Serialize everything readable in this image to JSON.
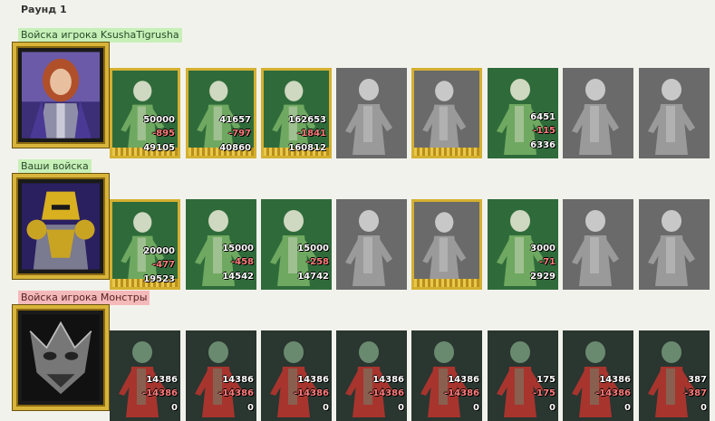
{
  "round": {
    "title": "Раунд 1"
  },
  "colors": {
    "label_green": "#c6f0b8",
    "label_red": "#f4b9b9",
    "gold_frame": "#d4b030",
    "loss_text": "#ff7c7c"
  },
  "sections": [
    {
      "label": "Войска игрока KsushaTigrusha",
      "hero_icon": "female-hero-portrait",
      "units": [
        {
          "icon": "dwarf-unit",
          "gold": true,
          "start": "50000",
          "loss": "-895",
          "remain": "49105",
          "shade": "green"
        },
        {
          "icon": "elf-swordsman-unit",
          "gold": true,
          "start": "41657",
          "loss": "-797",
          "remain": "40860",
          "shade": "green"
        },
        {
          "icon": "elf-lancer-unit",
          "gold": true,
          "start": "162653",
          "loss": "-1841",
          "remain": "160812",
          "shade": "green"
        },
        {
          "icon": "griffin-unit",
          "gold": false,
          "start": "",
          "loss": "",
          "remain": "",
          "shade": "gray"
        },
        {
          "icon": "archer-unit",
          "gold": true,
          "start": "",
          "loss": "",
          "remain": "",
          "shade": "gray"
        },
        {
          "icon": "druid-unit",
          "gold": false,
          "start": "6451",
          "loss": "-115",
          "remain": "6336",
          "shade": "green"
        },
        {
          "icon": "hooded-monk-unit",
          "gold": false,
          "start": "",
          "loss": "",
          "remain": "",
          "shade": "gray"
        },
        {
          "icon": "elder-mage-unit",
          "gold": false,
          "start": "",
          "loss": "",
          "remain": "",
          "shade": "gray"
        }
      ]
    },
    {
      "label": "Ваши войска",
      "hero_icon": "armored-knight-portrait",
      "units": [
        {
          "icon": "dwarf-unit",
          "gold": true,
          "start": "20000",
          "loss": "-477",
          "remain": "19523",
          "shade": "green"
        },
        {
          "icon": "elf-swordsman-unit",
          "gold": false,
          "start": "15000",
          "loss": "-458",
          "remain": "14542",
          "shade": "green"
        },
        {
          "icon": "elf-lancer-unit",
          "gold": false,
          "start": "15000",
          "loss": "-258",
          "remain": "14742",
          "shade": "green"
        },
        {
          "icon": "griffin-unit",
          "gold": false,
          "start": "",
          "loss": "",
          "remain": "",
          "shade": "gray"
        },
        {
          "icon": "archer-unit",
          "gold": true,
          "start": "",
          "loss": "",
          "remain": "",
          "shade": "gray"
        },
        {
          "icon": "druid-unit",
          "gold": false,
          "start": "3000",
          "loss": "-71",
          "remain": "2929",
          "shade": "green"
        },
        {
          "icon": "hooded-monk-unit",
          "gold": false,
          "start": "",
          "loss": "",
          "remain": "",
          "shade": "gray"
        },
        {
          "icon": "elder-mage-unit",
          "gold": false,
          "start": "",
          "loss": "",
          "remain": "",
          "shade": "gray"
        }
      ]
    },
    {
      "label": "Войска игрока Монстры",
      "hero_icon": "demon-mask-portrait",
      "units": [
        {
          "icon": "lizard-monster-unit",
          "gold": false,
          "start": "14386",
          "loss": "-14386",
          "remain": "0",
          "shade": "monster"
        },
        {
          "icon": "armored-brute-unit",
          "gold": false,
          "start": "14386",
          "loss": "-14386",
          "remain": "0",
          "shade": "monster"
        },
        {
          "icon": "naga-unit",
          "gold": false,
          "start": "14386",
          "loss": "-14386",
          "remain": "0",
          "shade": "monster"
        },
        {
          "icon": "winged-demon-unit",
          "gold": false,
          "start": "14386",
          "loss": "-14386",
          "remain": "0",
          "shade": "monster"
        },
        {
          "icon": "giant-spider-unit",
          "gold": false,
          "start": "14386",
          "loss": "-14386",
          "remain": "0",
          "shade": "monster"
        },
        {
          "icon": "red-beast-unit",
          "gold": false,
          "start": "175",
          "loss": "-175",
          "remain": "0",
          "shade": "monster"
        },
        {
          "icon": "blade-wraith-unit",
          "gold": false,
          "start": "14386",
          "loss": "-14386",
          "remain": "0",
          "shade": "monster"
        },
        {
          "icon": "serpent-lord-unit",
          "gold": false,
          "start": "387",
          "loss": "-387",
          "remain": "0",
          "shade": "monster"
        }
      ]
    }
  ]
}
